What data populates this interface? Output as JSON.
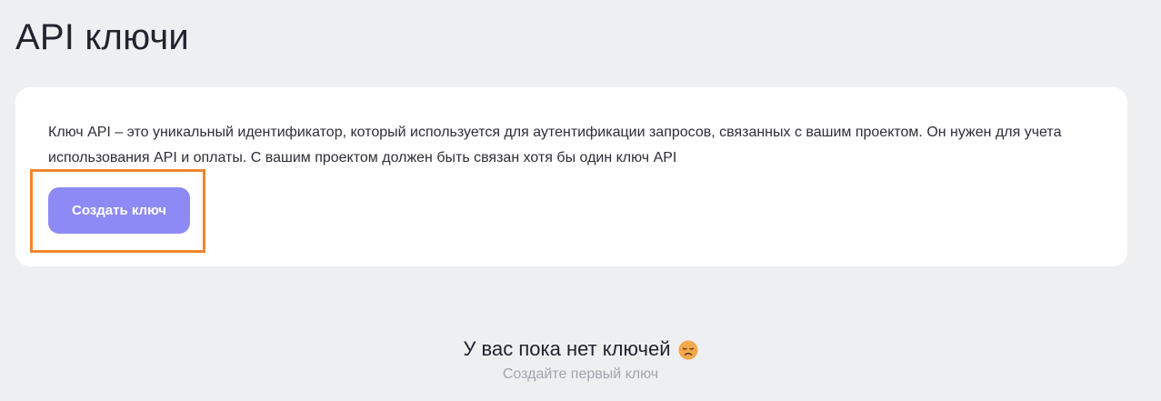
{
  "header": {
    "title": "API ключи"
  },
  "info_card": {
    "description": "Ключ API – это уникальный идентификатор, который используется для аутентификации запросов, связанных с вашим проектом. Он нужен для учета использования API и оплаты. С вашим проектом должен быть связан хотя бы один ключ API",
    "create_button_label": "Создать ключ"
  },
  "empty_state": {
    "title": "У вас пока нет ключей",
    "subtitle": "Создайте первый ключ",
    "icon": "sad-face-icon"
  },
  "colors": {
    "background": "#eeeff1",
    "card": "#ffffff",
    "accent": "#8e8af5",
    "highlight": "#f0862f",
    "muted_text": "#a3a4ad"
  }
}
